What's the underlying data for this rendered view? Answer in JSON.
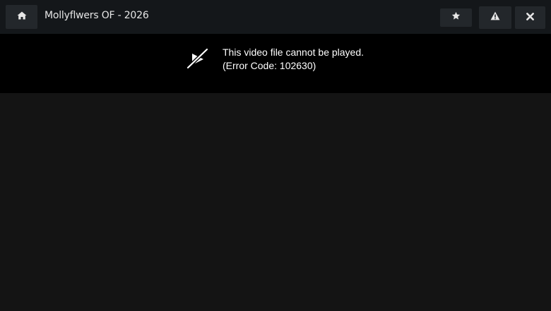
{
  "header": {
    "title": "Mollyflwers OF - 2026",
    "buttons": {
      "home_icon": "home-icon",
      "favorite_icon": "star-icon",
      "report_icon": "warning-icon",
      "close_icon": "close-icon"
    }
  },
  "player": {
    "error_icon": "video-unavailable-icon",
    "error_message": "This video file cannot be played.",
    "error_code": "(Error Code: 102630)"
  },
  "colors": {
    "topbar_bg": "#14171a",
    "button_bg": "#23272b",
    "player_bg": "#000000",
    "page_bg": "#141414",
    "text": "#ffffff"
  }
}
